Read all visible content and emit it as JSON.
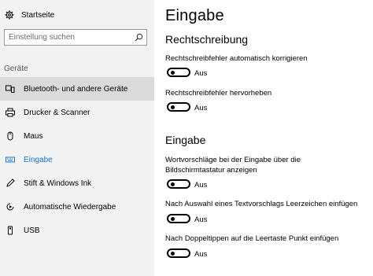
{
  "sidebar": {
    "home_label": "Startseite",
    "search_placeholder": "Einstellung suchen",
    "group_label": "Geräte",
    "items": [
      {
        "label": "Bluetooth- und andere Geräte",
        "icon": "bluetooth-icon"
      },
      {
        "label": "Drucker & Scanner",
        "icon": "printer-icon"
      },
      {
        "label": "Maus",
        "icon": "mouse-icon"
      },
      {
        "label": "Eingabe",
        "icon": "keyboard-icon"
      },
      {
        "label": "Stift & Windows Ink",
        "icon": "pen-icon"
      },
      {
        "label": "Automatische Wiedergabe",
        "icon": "autoplay-icon"
      },
      {
        "label": "USB",
        "icon": "usb-icon"
      }
    ],
    "hovered_item": "Bluetooth- und andere Geräte",
    "active_item": "Eingabe"
  },
  "main": {
    "title": "Eingabe",
    "sections": [
      {
        "title": "Rechtschreibung",
        "settings": [
          {
            "label": "Rechtschreibfehler automatisch korrigieren",
            "state": "Aus"
          },
          {
            "label": "Rechtschreibfehler hervorheben",
            "state": "Aus"
          }
        ]
      },
      {
        "title": "Eingabe",
        "settings": [
          {
            "label": "Wortvorschläge bei der Eingabe über die Bildschirmtastatur anzeigen",
            "state": "Aus"
          },
          {
            "label": "Nach Auswahl eines Textvorschlags Leerzeichen einfügen",
            "state": "Aus"
          },
          {
            "label": "Nach Doppeltippen auf die Leertaste Punkt einfügen",
            "state": "Aus"
          }
        ]
      }
    ]
  },
  "colors": {
    "accent": "#1a73c9",
    "sidebar_bg": "#f2f2f2",
    "hover_bg": "#dadada"
  }
}
